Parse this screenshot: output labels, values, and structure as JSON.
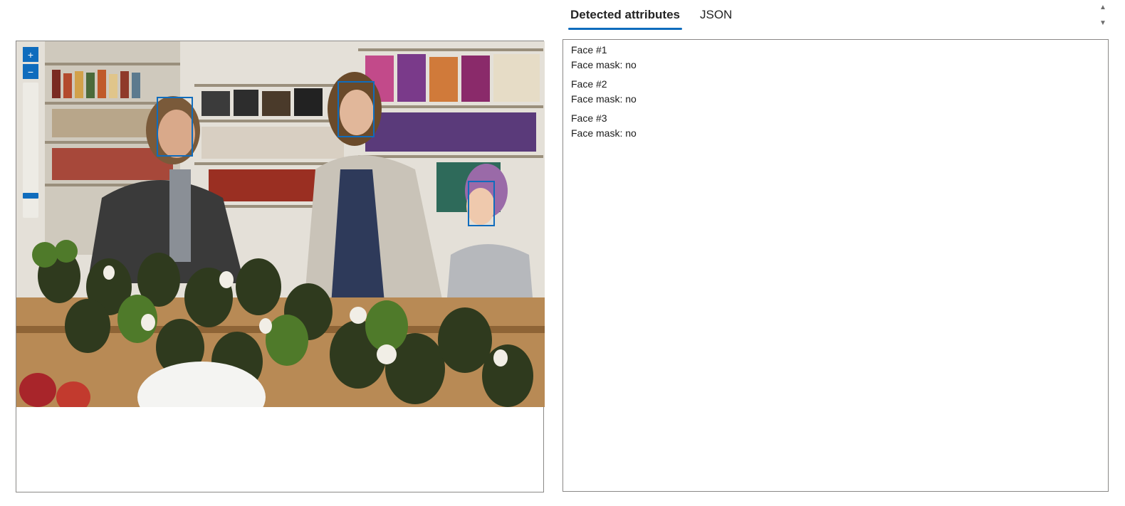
{
  "tabs": [
    {
      "label": "Detected attributes",
      "active": true
    },
    {
      "label": "JSON",
      "active": false
    }
  ],
  "viewer": {
    "zoom_in_label": "+",
    "zoom_out_label": "−",
    "zoom_level": 0.15,
    "accent_color": "#0f6cbd"
  },
  "faces": [
    {
      "title": "Face #1",
      "attribute": "Face mask: no"
    },
    {
      "title": "Face #2",
      "attribute": "Face mask: no"
    },
    {
      "title": "Face #3",
      "attribute": "Face mask: no"
    }
  ],
  "scroll": {
    "up_icon": "triangle-up-icon",
    "down_icon": "triangle-down-icon"
  }
}
